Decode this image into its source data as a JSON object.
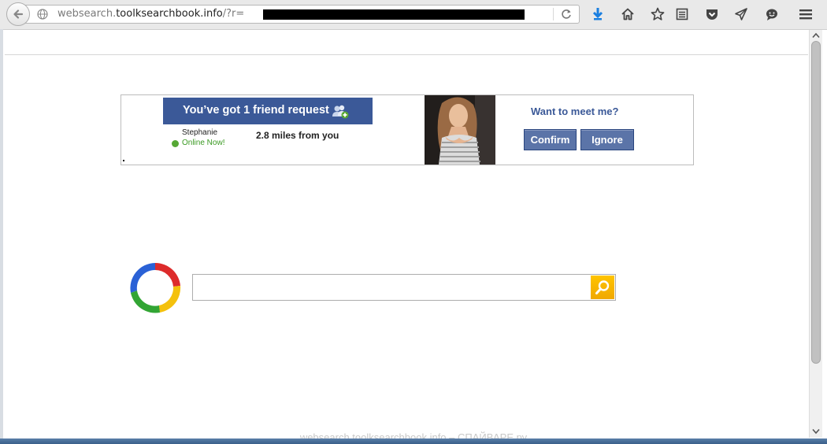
{
  "browser": {
    "url_prefix": "websearch.",
    "url_domain": "toolksearchbook.info",
    "url_path": "/?r="
  },
  "ad": {
    "friend_request_label": "You’ve got 1 friend request",
    "person_name": "Stephanie",
    "online_status": "Online Now!",
    "distance": "2.8 miles from you",
    "meet_label": "Want to meet me?",
    "confirm_label": "Confirm",
    "ignore_label": "Ignore"
  },
  "search": {
    "placeholder": ""
  },
  "watermark": "websearch.toolksearchbook.info – СПАЙВАРЕ.ру",
  "colors": {
    "facebook_blue": "#3b5998",
    "button_blue": "#5b74a8",
    "online_green": "#3a9a22",
    "search_button": "#ffc400"
  },
  "icons": [
    "back-arrow-icon",
    "globe-icon",
    "reload-icon",
    "download-icon",
    "home-icon",
    "bookmark-star-icon",
    "reading-list-icon",
    "pocket-icon",
    "send-icon",
    "chat-icon",
    "menu-icon",
    "friend-add-icon",
    "search-icon"
  ]
}
